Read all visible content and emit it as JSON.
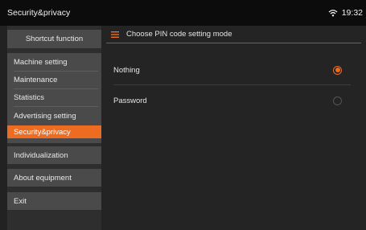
{
  "statusbar": {
    "title": "Security&privacy",
    "time": "19:32"
  },
  "sidebar": {
    "shortcut": "Shortcut function",
    "items": [
      {
        "label": "Machine setting",
        "selected": false
      },
      {
        "label": "Maintenance",
        "selected": false
      },
      {
        "label": "Statistics",
        "selected": false
      },
      {
        "label": "Advertising setting",
        "selected": false
      },
      {
        "label": "Security&privacy",
        "selected": true
      }
    ],
    "individualization": "Individualization",
    "about": "About equipment",
    "exit": "Exit"
  },
  "content": {
    "header": "Choose PIN code setting mode",
    "options": [
      {
        "label": "Nothing",
        "checked": true
      },
      {
        "label": "Password",
        "checked": false
      }
    ]
  },
  "colors": {
    "accent": "#ee6c22",
    "statusbar": "#0c0c0c",
    "panel": "#4a4a4a",
    "background": "#242424"
  }
}
